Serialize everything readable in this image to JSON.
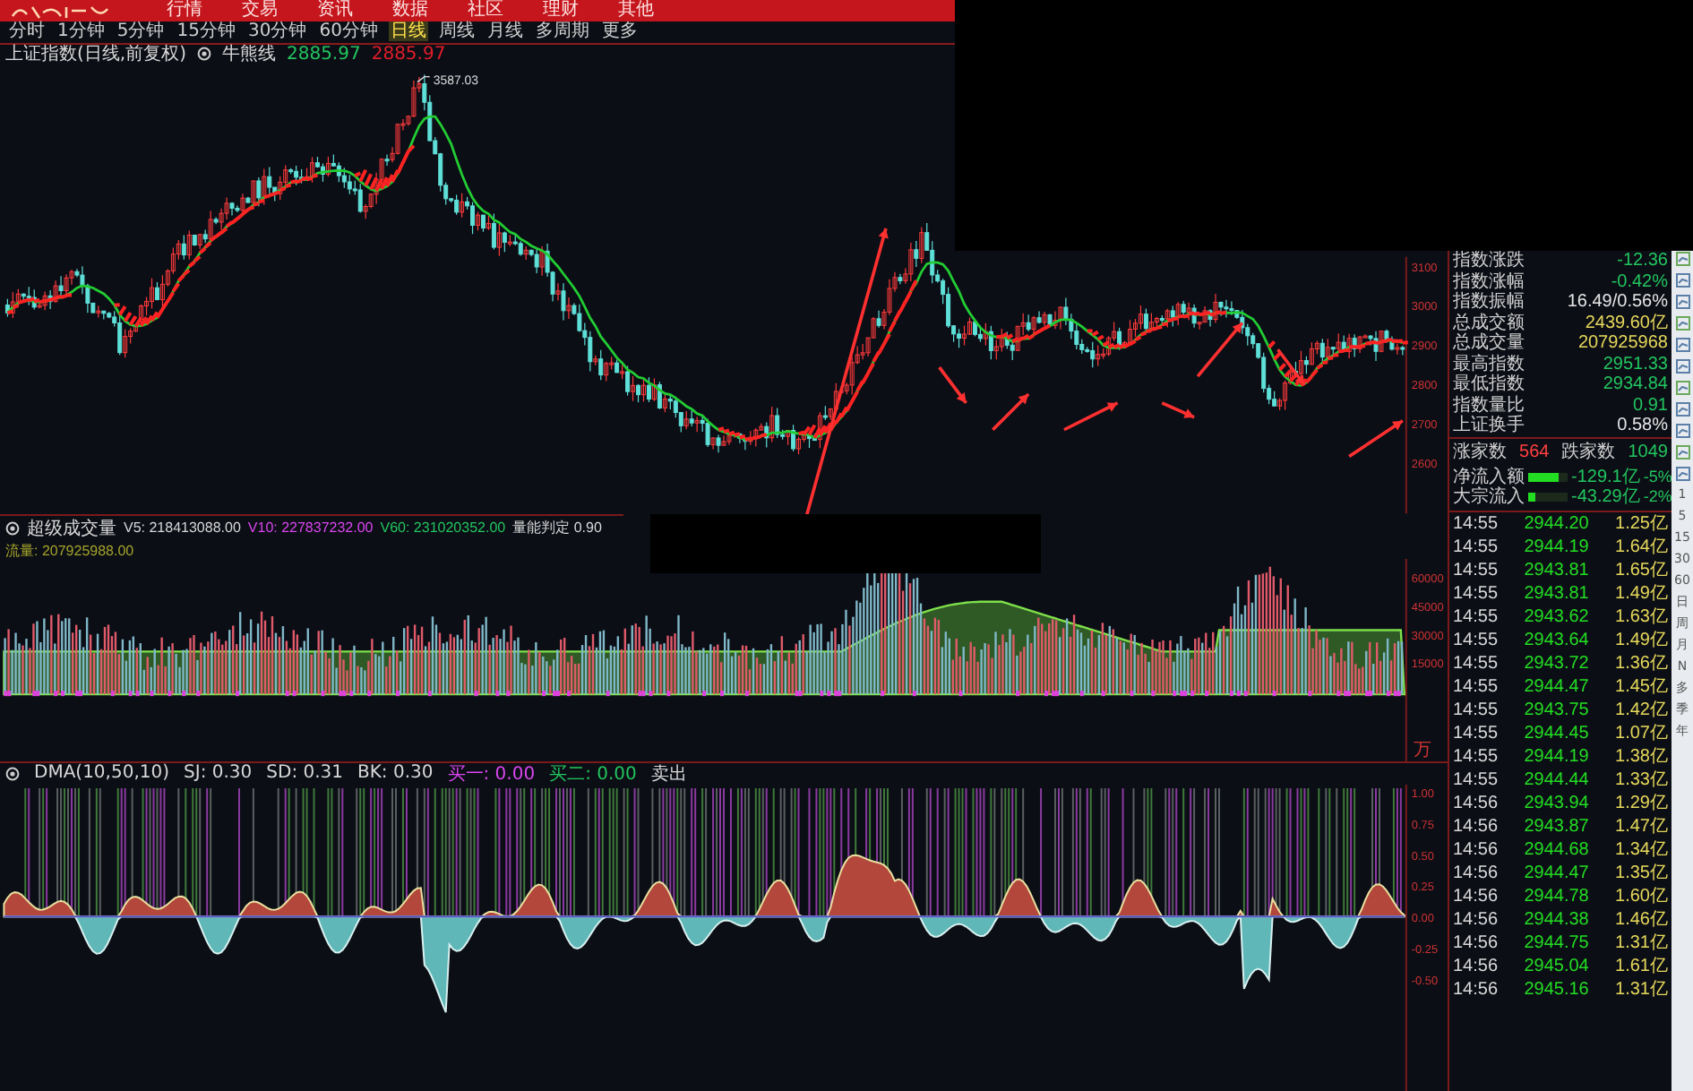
{
  "menu_bar": {
    "items": [
      "行情",
      "交易",
      "资讯",
      "数据",
      "社区",
      "理财",
      "其他"
    ]
  },
  "period_tabs": [
    {
      "label": "分时",
      "selected": false
    },
    {
      "label": "1分钟",
      "selected": false
    },
    {
      "label": "5分钟",
      "selected": false
    },
    {
      "label": "15分钟",
      "selected": false
    },
    {
      "label": "30分钟",
      "selected": false
    },
    {
      "label": "60分钟",
      "selected": false
    },
    {
      "label": "日线",
      "selected": true
    },
    {
      "label": "周线",
      "selected": false
    },
    {
      "label": "月线",
      "selected": false
    },
    {
      "label": "多周期",
      "selected": false
    },
    {
      "label": "更多",
      "selected": false
    }
  ],
  "price_panel": {
    "title": "上证指数(日线,前复权)",
    "indicator": "牛熊线",
    "values": [
      {
        "text": "2885.97",
        "color": "#22c55e"
      },
      {
        "text": "2885.97",
        "color": "#e11d2a"
      }
    ],
    "peak_label": "3587.03",
    "axis_labels": [
      "3100",
      "3000",
      "2900",
      "2800",
      "2700",
      "2600"
    ]
  },
  "volume_panel": {
    "title": "超级成交量",
    "values": [
      {
        "text": "V5: 218413088.00",
        "color": "#d8d8d8"
      },
      {
        "text": "V10: 227837232.00",
        "color": "#d946ef"
      },
      {
        "text": "V60: 231020352.00",
        "color": "#22c55e"
      },
      {
        "text": "量能判定 0.90",
        "color": "#d8d8d8"
      },
      {
        "text": "流量: 207925988.00",
        "color": "#a3a32a"
      }
    ],
    "axis_labels": [
      "60000",
      "45000",
      "30000",
      "15000"
    ],
    "unit": "万"
  },
  "dma_panel": {
    "title": "DMA(10,50,10)",
    "values": [
      {
        "text": "SJ: 0.30",
        "color": "#d8d8d8"
      },
      {
        "text": "SD: 0.31",
        "color": "#d8d8d8"
      },
      {
        "text": "BK: 0.30",
        "color": "#d8d8d8"
      },
      {
        "text": "买一: 0.00",
        "color": "#d946ef"
      },
      {
        "text": "买二: 0.00",
        "color": "#22c55e"
      },
      {
        "text": "卖出",
        "color": "#d8d8d8"
      }
    ],
    "axis_labels": [
      "1.00",
      "0.75",
      "0.50",
      "0.25",
      "0.00",
      "-0.25",
      "-0.50"
    ]
  },
  "info": [
    {
      "label": "指数涨跌",
      "value": "-12.36",
      "color": "#22c55e"
    },
    {
      "label": "指数涨幅",
      "value": "-0.42%",
      "color": "#22c55e"
    },
    {
      "label": "指数振幅",
      "value": "16.49/0.56%",
      "color": "#e5e5e5"
    },
    {
      "label": "总成交额",
      "value": "2439.60亿",
      "color": "#e5d85a"
    },
    {
      "label": "总成交量",
      "value": "207925968",
      "color": "#e5d85a"
    },
    {
      "label": "最高指数",
      "value": "2951.33",
      "color": "#22c55e"
    },
    {
      "label": "最低指数",
      "value": "2934.84",
      "color": "#22c55e"
    },
    {
      "label": "指数量比",
      "value": "0.91",
      "color": "#22c55e"
    },
    {
      "label": "上证换手",
      "value": "0.58%",
      "color": "#e5e5e5"
    }
  ],
  "breadth": {
    "up_label": "涨家数",
    "up_count": "564",
    "down_label": "跌家数",
    "down_count": "1049"
  },
  "flows": [
    {
      "label": "净流入额",
      "level": 0.75,
      "amount": "-129.1亿",
      "percent": "-5%"
    },
    {
      "label": "大宗流入",
      "level": 0.2,
      "amount": "-43.29亿",
      "percent": "-2%"
    }
  ],
  "ticks": [
    {
      "time": "14:55",
      "price": "2944.20",
      "amount": "1.25亿"
    },
    {
      "time": "14:55",
      "price": "2944.19",
      "amount": "1.64亿"
    },
    {
      "time": "14:55",
      "price": "2943.81",
      "amount": "1.65亿"
    },
    {
      "time": "14:55",
      "price": "2943.81",
      "amount": "1.49亿"
    },
    {
      "time": "14:55",
      "price": "2943.62",
      "amount": "1.63亿"
    },
    {
      "time": "14:55",
      "price": "2943.64",
      "amount": "1.49亿"
    },
    {
      "time": "14:55",
      "price": "2943.72",
      "amount": "1.36亿"
    },
    {
      "time": "14:55",
      "price": "2944.47",
      "amount": "1.45亿"
    },
    {
      "time": "14:55",
      "price": "2943.75",
      "amount": "1.42亿"
    },
    {
      "time": "14:55",
      "price": "2944.45",
      "amount": "1.07亿"
    },
    {
      "time": "14:55",
      "price": "2944.19",
      "amount": "1.38亿"
    },
    {
      "time": "14:55",
      "price": "2944.44",
      "amount": "1.33亿"
    },
    {
      "time": "14:56",
      "price": "2943.94",
      "amount": "1.29亿"
    },
    {
      "time": "14:56",
      "price": "2943.87",
      "amount": "1.47亿"
    },
    {
      "time": "14:56",
      "price": "2944.68",
      "amount": "1.34亿"
    },
    {
      "time": "14:56",
      "price": "2944.47",
      "amount": "1.35亿"
    },
    {
      "time": "14:56",
      "price": "2944.78",
      "amount": "1.60亿"
    },
    {
      "time": "14:56",
      "price": "2944.38",
      "amount": "1.46亿"
    },
    {
      "time": "14:56",
      "price": "2944.75",
      "amount": "1.31亿"
    },
    {
      "time": "14:56",
      "price": "2945.04",
      "amount": "1.61亿"
    },
    {
      "time": "14:56",
      "price": "2945.16",
      "amount": "1.31亿"
    }
  ],
  "toolbar_keys": [
    "1",
    "5",
    "15",
    "30",
    "60",
    "日",
    "周",
    "月",
    "N",
    "多",
    "季",
    "年"
  ]
}
